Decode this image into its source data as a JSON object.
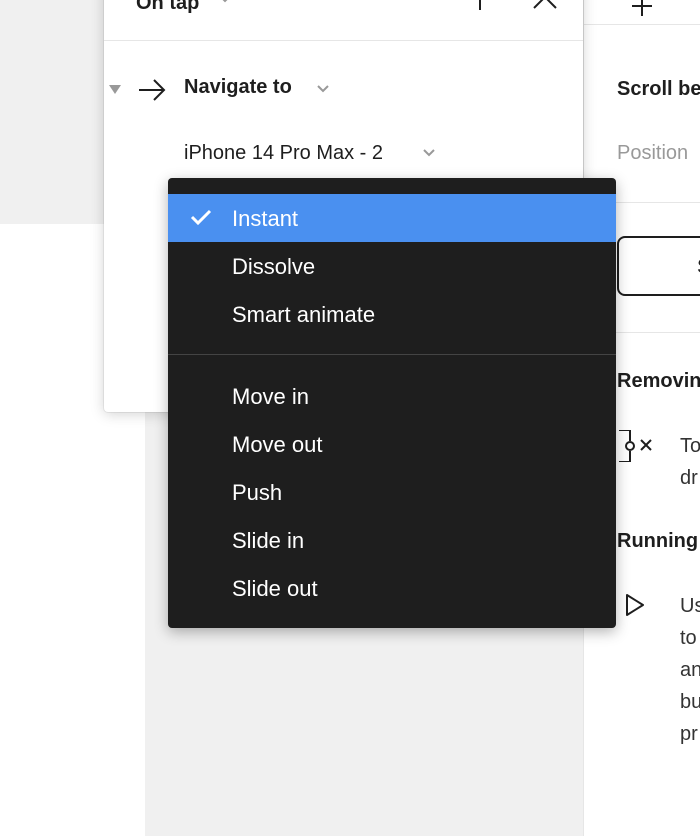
{
  "popover": {
    "title": "On tap",
    "action": "Navigate to",
    "destination": "iPhone 14 Pro Max - 2"
  },
  "right_panel": {
    "scroll_heading": "Scroll be",
    "position_label": "Position",
    "button_label": "S",
    "removing_heading": "Removin",
    "removing_text": [
      "To",
      "dr"
    ],
    "running_heading": "Running",
    "running_text": [
      "Us",
      "to",
      "an",
      "bu",
      "pr"
    ]
  },
  "dropdown": {
    "selected": "Instant",
    "group1": [
      "Instant",
      "Dissolve",
      "Smart animate"
    ],
    "group2": [
      "Move in",
      "Move out",
      "Push",
      "Slide in",
      "Slide out"
    ]
  },
  "colors": {
    "dropdown_bg": "#1e1e1e",
    "selected_bg": "#4a90f0",
    "canvas_bg": "#f0f0f0"
  },
  "icons": [
    "chevron-down-icon",
    "add-icon",
    "close-icon",
    "collapse-triangle-icon",
    "arrow-right-icon",
    "check-icon",
    "remove-connection-icon",
    "play-icon",
    "plus-icon"
  ]
}
